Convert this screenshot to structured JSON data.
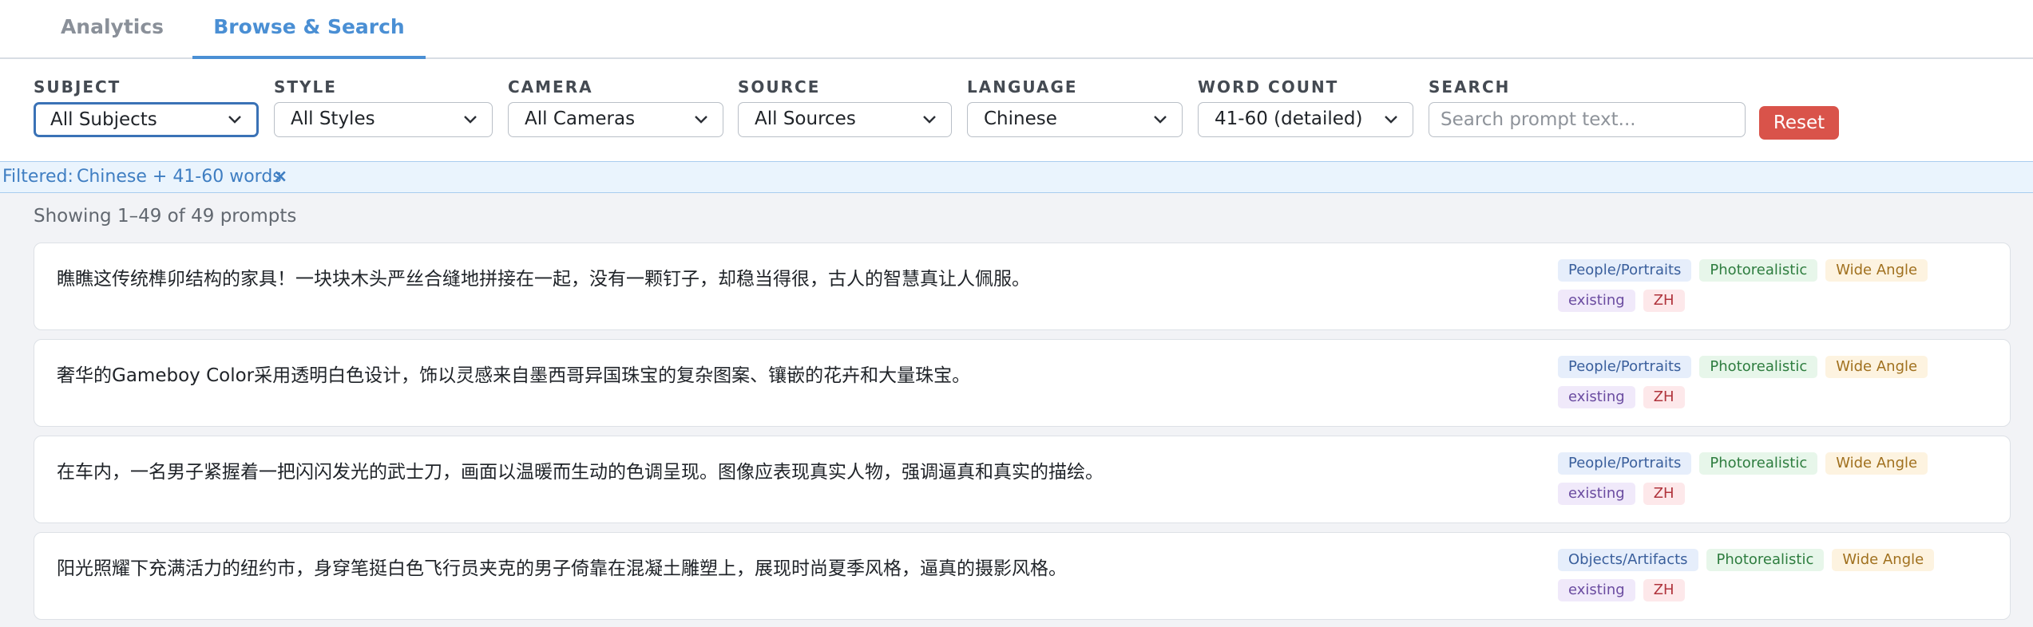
{
  "tabs": [
    {
      "label": "Analytics",
      "active": false
    },
    {
      "label": "Browse & Search",
      "active": true
    }
  ],
  "filters": {
    "subject": {
      "label": "SUBJECT",
      "value": "All Subjects"
    },
    "style": {
      "label": "STYLE",
      "value": "All Styles"
    },
    "camera": {
      "label": "CAMERA",
      "value": "All Cameras"
    },
    "source": {
      "label": "SOURCE",
      "value": "All Sources"
    },
    "language": {
      "label": "LANGUAGE",
      "value": "Chinese"
    },
    "word_count": {
      "label": "WORD COUNT",
      "value": "41-60 (detailed)"
    },
    "search": {
      "label": "SEARCH",
      "placeholder": "Search prompt text...",
      "value": ""
    },
    "reset_label": "Reset"
  },
  "filter_bar": {
    "label": "Filtered:",
    "value": "Chinese + 41-60 words",
    "clear": "×"
  },
  "results": {
    "summary": "Showing 1–49 of 49 prompts"
  },
  "prompts": [
    {
      "text": "瞧瞧这传统榫卯结构的家具！一块块木头严丝合缝地拼接在一起，没有一颗钉子，却稳当得很，古人的智慧真让人佩服。",
      "subject": "People/Portraits",
      "style": "Photorealistic",
      "camera": "Wide Angle",
      "source": "existing",
      "lang": "ZH"
    },
    {
      "text": "奢华的Gameboy Color采用透明白色设计，饰以灵感来自墨西哥异国珠宝的复杂图案、镶嵌的花卉和大量珠宝。",
      "subject": "People/Portraits",
      "style": "Photorealistic",
      "camera": "Wide Angle",
      "source": "existing",
      "lang": "ZH"
    },
    {
      "text": "在车内，一名男子紧握着一把闪闪发光的武士刀，画面以温暖而生动的色调呈现。图像应表现真实人物，强调逼真和真实的描绘。",
      "subject": "People/Portraits",
      "style": "Photorealistic",
      "camera": "Wide Angle",
      "source": "existing",
      "lang": "ZH"
    },
    {
      "text": "阳光照耀下充满活力的纽约市，身穿笔挺白色飞行员夹克的男子倚靠在混凝土雕塑上，展现时尚夏季风格，逼真的摄影风格。",
      "subject": "Objects/Artifacts",
      "style": "Photorealistic",
      "camera": "Wide Angle",
      "source": "existing",
      "lang": "ZH"
    }
  ]
}
